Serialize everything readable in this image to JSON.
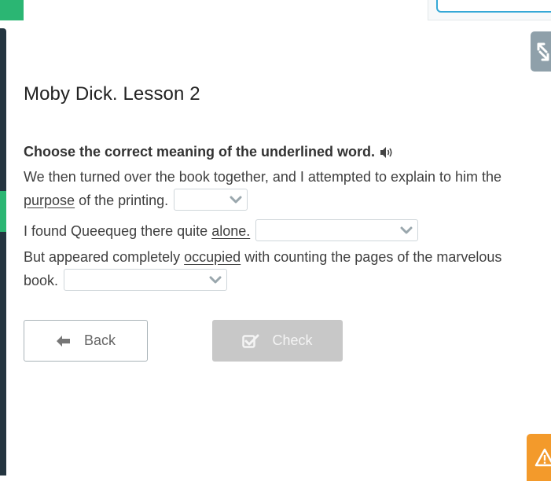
{
  "lesson": {
    "title": "Moby Dick. Lesson 2"
  },
  "question": {
    "prompt": "Choose the correct meaning of the underlined word."
  },
  "sentences": [
    {
      "before": "We then turned over the book together, and I attempted to explain to him the ",
      "underlined": "purpose",
      "after": " of the printing.",
      "selected": ""
    },
    {
      "before": "I found Queequeg there quite ",
      "underlined": "alone.",
      "after": "",
      "selected": ""
    },
    {
      "before": "But appeared completely ",
      "underlined": "occupied",
      "after": " with counting the pages of the marvelous book.",
      "selected": ""
    }
  ],
  "buttons": {
    "back": "Back",
    "check": "Check"
  },
  "icons": {
    "speaker": "speaker-icon",
    "back": "arrow-left-icon",
    "check": "checkbox-check-icon",
    "fullscreen": "expand-icon",
    "warning": "warning-icon",
    "dropdown": "chevron-down-icon"
  },
  "colors": {
    "accent_green": "#2bb673",
    "sidebar_dark": "#243540",
    "warning_orange": "#f39a2b",
    "check_disabled": "#c8c8c8",
    "link_blue": "#35a8d6"
  }
}
